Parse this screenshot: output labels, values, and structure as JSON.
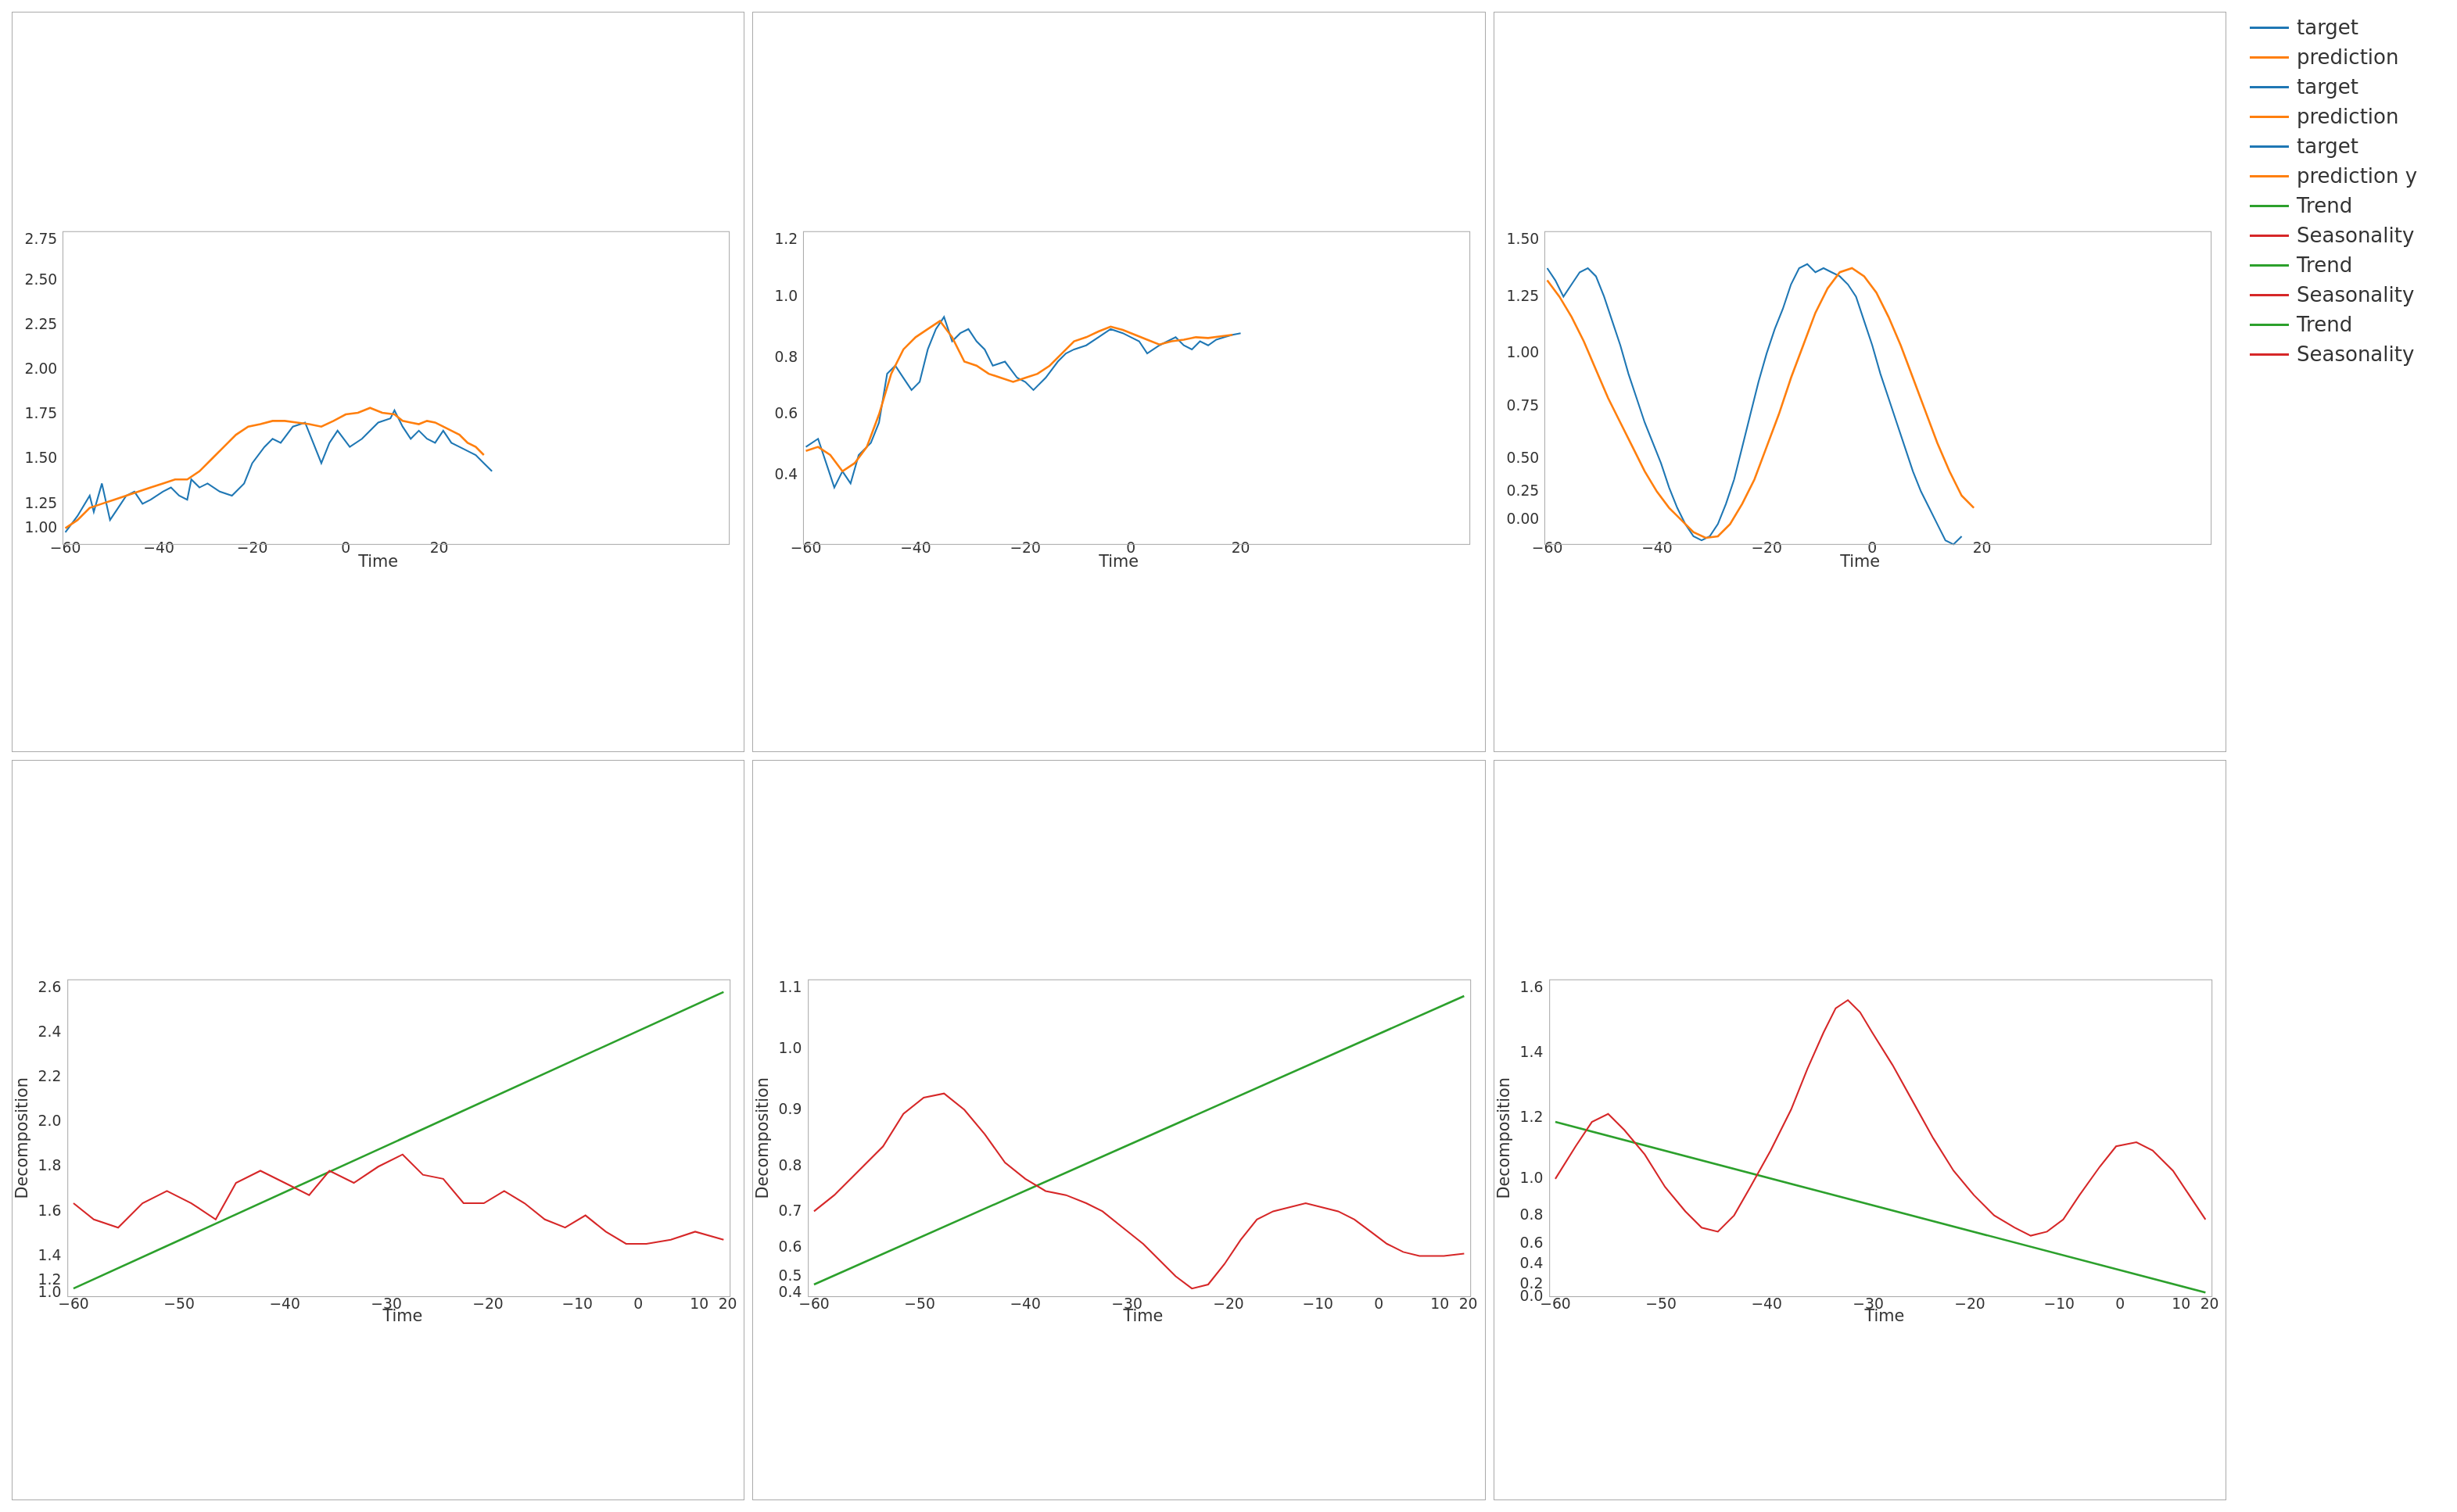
{
  "legend": {
    "items": [
      {
        "label": "target",
        "color": "#1f77b4",
        "type": "line"
      },
      {
        "label": "prediction",
        "color": "#ff7f0e",
        "type": "line"
      },
      {
        "label": "target",
        "color": "#1f77b4",
        "type": "line"
      },
      {
        "label": "prediction",
        "color": "#ff7f0e",
        "type": "line"
      },
      {
        "label": "target",
        "color": "#1f77b4",
        "type": "line"
      },
      {
        "label": "prediction y",
        "color": "#ff7f0e",
        "type": "line"
      },
      {
        "label": "Trend",
        "color": "#2ca02c",
        "type": "line"
      },
      {
        "label": "Seasonality",
        "color": "#d62728",
        "type": "line"
      },
      {
        "label": "Trend",
        "color": "#2ca02c",
        "type": "line"
      },
      {
        "label": "Seasonality",
        "color": "#d62728",
        "type": "line"
      },
      {
        "label": "Trend",
        "color": "#2ca02c",
        "type": "line"
      },
      {
        "label": "Seasonality",
        "color": "#d62728",
        "type": "line"
      }
    ]
  },
  "charts": {
    "top_row": [
      {
        "id": "top-left",
        "x_label": "Time",
        "y_min": 1.0,
        "y_max": 2.75
      },
      {
        "id": "top-middle",
        "x_label": "Time",
        "y_min": 0.4,
        "y_max": 1.2
      },
      {
        "id": "top-right",
        "x_label": "Time",
        "y_min": -0.25,
        "y_max": 1.5
      }
    ],
    "bottom_row": [
      {
        "id": "bottom-left",
        "x_label": "Time",
        "y_label": "Decomposition",
        "y_min": 1.0,
        "y_max": 2.6
      },
      {
        "id": "bottom-middle",
        "x_label": "Time",
        "y_label": "Decomposition",
        "y_min": 0.4,
        "y_max": 1.1
      },
      {
        "id": "bottom-right",
        "x_label": "Time",
        "y_label": "Decomposition",
        "y_min": 0.0,
        "y_max": 1.6
      }
    ]
  }
}
